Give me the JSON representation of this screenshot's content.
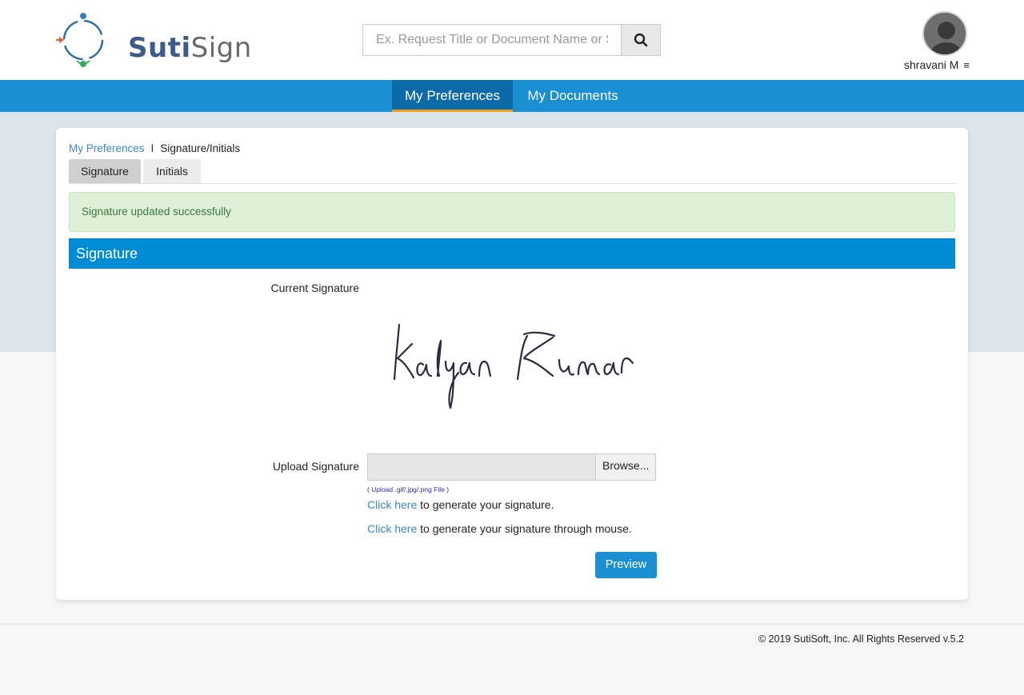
{
  "header": {
    "logo_text_a": "Suti",
    "logo_text_b": "Sign",
    "search_placeholder": "Ex. Request Title or Document Name or S",
    "search_icon": "search-icon",
    "user_name": "shravani M",
    "menu_icon": "≡"
  },
  "nav": {
    "tabs": [
      {
        "label": "My Preferences",
        "active": true
      },
      {
        "label": "My Documents",
        "active": false
      }
    ]
  },
  "breadcrumb": {
    "parent": "My Preferences",
    "separator": "I",
    "current": "Signature/Initials"
  },
  "subtabs": [
    {
      "label": "Signature",
      "active": true
    },
    {
      "label": "Initials",
      "active": false
    }
  ],
  "alert": {
    "message": "Signature updated successfully"
  },
  "section": {
    "title": "Signature"
  },
  "form": {
    "current_signature_label": "Current Signature",
    "signature_image_text": "Kalyan Kumar",
    "upload_label": "Upload Signature",
    "browse_label": "Browse...",
    "upload_hint": "( Upload .gif/.jpg/.png File )",
    "gen_link_1": "Click here",
    "gen_text_1": " to generate your signature.",
    "gen_link_2": "Click here",
    "gen_text_2": " to generate your signature through mouse.",
    "preview_label": "Preview"
  },
  "footer": {
    "text": "© 2019 SutiSoft, Inc. All Rights Reserved v.5.2"
  },
  "colors": {
    "nav_blue": "#1a8fd2",
    "nav_active": "#0c6aa8",
    "nav_underline": "#f0a01c",
    "section_blue": "#008bd5",
    "alert_bg": "#dff0d8",
    "link": "#3a87c9"
  }
}
